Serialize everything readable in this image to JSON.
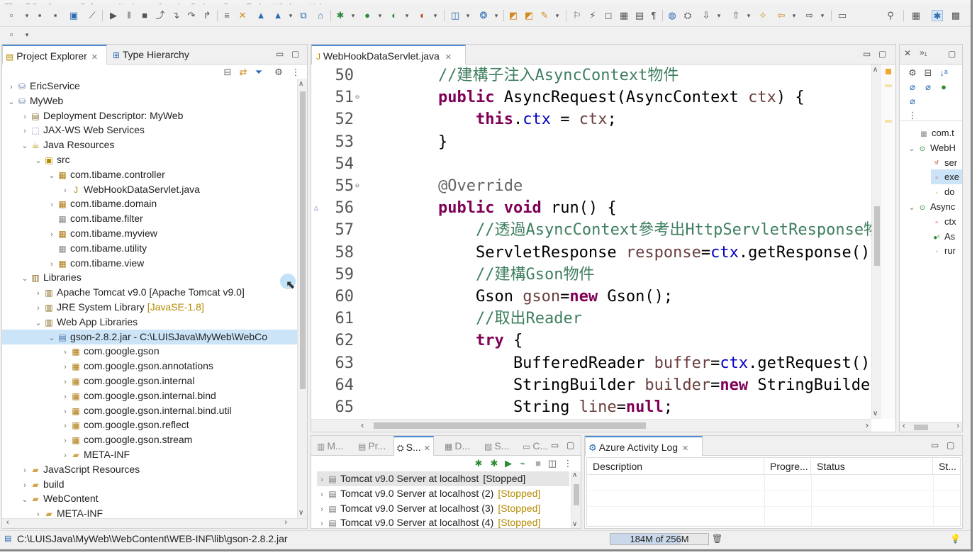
{
  "menu": [
    "File",
    "Edit",
    "Source",
    "Refactor",
    "Navigate",
    "Search",
    "Project",
    "Run",
    "Tools",
    "Window",
    "Help"
  ],
  "explorer": {
    "tabs": [
      "Project Explorer",
      "Type Hierarchy"
    ],
    "items": [
      {
        "label": "EricService",
        "level": 0,
        "twisty": "›",
        "icon": "project-icon"
      },
      {
        "label": "MyWeb",
        "level": 0,
        "twisty": "⌄",
        "icon": "project-icon"
      },
      {
        "label": "Deployment Descriptor: MyWeb",
        "level": 1,
        "twisty": "›",
        "icon": "descriptor-icon"
      },
      {
        "label": "JAX-WS Web Services",
        "level": 1,
        "twisty": "›",
        "icon": "webservice-icon"
      },
      {
        "label": "Java Resources",
        "level": 1,
        "twisty": "⌄",
        "icon": "java-resources-icon"
      },
      {
        "label": "src",
        "level": 2,
        "twisty": "⌄",
        "icon": "source-folder-icon"
      },
      {
        "label": "com.tibame.controller",
        "level": 3,
        "twisty": "⌄",
        "icon": "package-icon"
      },
      {
        "label": "WebHookDataServlet.java",
        "level": 4,
        "twisty": "›",
        "icon": "java-file-icon"
      },
      {
        "label": "com.tibame.domain",
        "level": 3,
        "twisty": "›",
        "icon": "package-icon"
      },
      {
        "label": "com.tibame.filter",
        "level": 3,
        "twisty": "",
        "icon": "empty-package-icon"
      },
      {
        "label": "com.tibame.myview",
        "level": 3,
        "twisty": "›",
        "icon": "package-icon"
      },
      {
        "label": "com.tibame.utility",
        "level": 3,
        "twisty": "",
        "icon": "empty-package-icon"
      },
      {
        "label": "com.tibame.view",
        "level": 3,
        "twisty": "›",
        "icon": "package-icon"
      },
      {
        "label": "Libraries",
        "level": 1,
        "twisty": "⌄",
        "icon": "library-icon"
      },
      {
        "label": "Apache Tomcat v9.0 [Apache Tomcat v9.0]",
        "level": 2,
        "twisty": "›",
        "icon": "library-icon"
      },
      {
        "label": "JRE System Library",
        "deco": "[JavaSE-1.8]",
        "level": 2,
        "twisty": "›",
        "icon": "library-icon"
      },
      {
        "label": "Web App Libraries",
        "level": 2,
        "twisty": "⌄",
        "icon": "library-icon"
      },
      {
        "label": "gson-2.8.2.jar - C:\\LUISJava\\MyWeb\\WebCo",
        "level": 3,
        "twisty": "⌄",
        "icon": "jar-icon",
        "selected": true
      },
      {
        "label": "com.google.gson",
        "level": 4,
        "twisty": "›",
        "icon": "package-icon"
      },
      {
        "label": "com.google.gson.annotations",
        "level": 4,
        "twisty": "›",
        "icon": "package-icon"
      },
      {
        "label": "com.google.gson.internal",
        "level": 4,
        "twisty": "›",
        "icon": "package-icon"
      },
      {
        "label": "com.google.gson.internal.bind",
        "level": 4,
        "twisty": "›",
        "icon": "package-icon"
      },
      {
        "label": "com.google.gson.internal.bind.util",
        "level": 4,
        "twisty": "›",
        "icon": "package-icon"
      },
      {
        "label": "com.google.gson.reflect",
        "level": 4,
        "twisty": "›",
        "icon": "package-icon"
      },
      {
        "label": "com.google.gson.stream",
        "level": 4,
        "twisty": "›",
        "icon": "package-icon"
      },
      {
        "label": "META-INF",
        "level": 4,
        "twisty": "›",
        "icon": "folder-icon"
      },
      {
        "label": "JavaScript Resources",
        "level": 0,
        "twisty": "›",
        "icon": "folder-icon",
        "indentBase": 1
      },
      {
        "label": "build",
        "level": 0,
        "twisty": "›",
        "icon": "folder-icon",
        "indentBase": 1
      },
      {
        "label": "WebContent",
        "level": 0,
        "twisty": "⌄",
        "icon": "folder-icon",
        "indentBase": 1
      },
      {
        "label": "META-INF",
        "level": 1,
        "twisty": "›",
        "icon": "folder-icon",
        "indentBase": 1
      }
    ]
  },
  "editor": {
    "tab": "WebHookDataServlet.java",
    "lines": [
      {
        "n": "50",
        "fold": "",
        "tokens": [
          [
            "    ",
            ""
          ],
          [
            "//建構子注入AsyncContext物件",
            "cm"
          ]
        ]
      },
      {
        "n": "51",
        "fold": "⊖",
        "tokens": [
          [
            "    ",
            ""
          ],
          [
            "public",
            "kw"
          ],
          [
            " AsyncRequest(AsyncContext ",
            ""
          ],
          [
            "ctx",
            "vr"
          ],
          [
            ") {",
            ""
          ]
        ]
      },
      {
        "n": "52",
        "fold": "",
        "tokens": [
          [
            "        ",
            ""
          ],
          [
            "this",
            "kw"
          ],
          [
            ".",
            ""
          ],
          [
            "ctx",
            "fd"
          ],
          [
            " = ",
            ""
          ],
          [
            "ctx",
            "vr"
          ],
          [
            ";",
            ""
          ]
        ]
      },
      {
        "n": "53",
        "fold": "",
        "tokens": [
          [
            "    }",
            ""
          ]
        ]
      },
      {
        "n": "54",
        "fold": "",
        "tokens": [
          [
            "",
            ""
          ]
        ]
      },
      {
        "n": "55",
        "fold": "⊖",
        "tokens": [
          [
            "    ",
            ""
          ],
          [
            "@Override",
            "an"
          ]
        ]
      },
      {
        "n": "56",
        "fold": "△",
        "tokens": [
          [
            "    ",
            ""
          ],
          [
            "public",
            "kw"
          ],
          [
            " ",
            ""
          ],
          [
            "void",
            "kw"
          ],
          [
            " run() {",
            ""
          ]
        ]
      },
      {
        "n": "57",
        "fold": "",
        "tokens": [
          [
            "        ",
            ""
          ],
          [
            "//透過AsyncContext參考出HttpServletResponse物",
            "cm"
          ]
        ]
      },
      {
        "n": "58",
        "fold": "",
        "tokens": [
          [
            "        ServletResponse ",
            ""
          ],
          [
            "response",
            "vr"
          ],
          [
            "=",
            ""
          ],
          [
            "ctx",
            "fd"
          ],
          [
            ".getResponse();",
            ""
          ]
        ]
      },
      {
        "n": "59",
        "fold": "",
        "tokens": [
          [
            "        ",
            ""
          ],
          [
            "//建構Gson物件",
            "cm"
          ]
        ]
      },
      {
        "n": "60",
        "fold": "",
        "tokens": [
          [
            "        Gson ",
            ""
          ],
          [
            "gson",
            "vr"
          ],
          [
            "=",
            ""
          ],
          [
            "new",
            "kw"
          ],
          [
            " Gson();",
            ""
          ]
        ]
      },
      {
        "n": "61",
        "fold": "",
        "tokens": [
          [
            "        ",
            ""
          ],
          [
            "//取出Reader",
            "cm"
          ]
        ]
      },
      {
        "n": "62",
        "fold": "",
        "tokens": [
          [
            "        ",
            ""
          ],
          [
            "try",
            "kw"
          ],
          [
            " {",
            ""
          ]
        ]
      },
      {
        "n": "63",
        "fold": "",
        "tokens": [
          [
            "            BufferedReader ",
            ""
          ],
          [
            "buffer",
            "vr"
          ],
          [
            "=",
            ""
          ],
          [
            "ctx",
            "fd"
          ],
          [
            ".getRequest().",
            ""
          ]
        ]
      },
      {
        "n": "64",
        "fold": "",
        "tokens": [
          [
            "            StringBuilder ",
            ""
          ],
          [
            "builder",
            "vr"
          ],
          [
            "=",
            ""
          ],
          [
            "new",
            "kw"
          ],
          [
            " StringBuilder",
            ""
          ]
        ]
      },
      {
        "n": "65",
        "fold": "",
        "tokens": [
          [
            "            String ",
            ""
          ],
          [
            "line",
            "vr"
          ],
          [
            "=",
            ""
          ],
          [
            "null",
            "kw"
          ],
          [
            ";",
            ""
          ]
        ]
      }
    ]
  },
  "outline": {
    "items": [
      {
        "label": "com.t",
        "icon": "import-icon",
        "twisty": ""
      },
      {
        "label": "WebH",
        "icon": "class-icon",
        "twisty": "⌄"
      },
      {
        "label": "ser",
        "icon": "static-field-icon",
        "twisty": ""
      },
      {
        "label": "exe",
        "icon": "private-field-icon",
        "twisty": "",
        "selected": true
      },
      {
        "label": "do",
        "icon": "method-icon",
        "twisty": ""
      },
      {
        "label": "Async",
        "icon": "class-icon",
        "twisty": "⌄"
      },
      {
        "label": "ctx",
        "icon": "private-field-icon",
        "twisty": ""
      },
      {
        "label": "As",
        "icon": "constructor-icon",
        "twisty": ""
      },
      {
        "label": "rur",
        "icon": "method-icon",
        "twisty": ""
      }
    ]
  },
  "servers": {
    "tabs": [
      "M...",
      "Pr...",
      "S...",
      "D...",
      "S...",
      "C..."
    ],
    "rows": [
      {
        "label": "Tomcat v9.0 Server at localhost",
        "status": "[Stopped]"
      },
      {
        "label": "Tomcat v9.0 Server at localhost (2)",
        "status": "[Stopped]"
      },
      {
        "label": "Tomcat v9.0 Server at localhost (3)",
        "status": "[Stopped]"
      },
      {
        "label": "Tomcat v9.0 Server at localhost (4)",
        "status": "[Stopped]"
      }
    ]
  },
  "azure": {
    "tab": "Azure Activity Log",
    "columns": [
      "Description",
      "Progre...",
      "Status",
      "St..."
    ]
  },
  "status": {
    "path": "C:\\LUISJava\\MyWeb\\WebContent\\WEB-INF\\lib\\gson-2.8.2.jar",
    "memory": "184M of 256M",
    "memory_used_fraction": 0.72
  }
}
